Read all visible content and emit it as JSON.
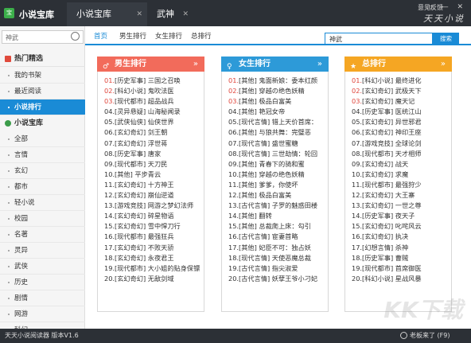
{
  "app": {
    "title": "小说宝库",
    "logo": "宝",
    "feedback": "意见反馈",
    "window_controls": "▭ — ✕",
    "brand": "天天小说"
  },
  "tabs": [
    {
      "label": "小说宝库",
      "close": "✕"
    },
    {
      "label": "武神",
      "close": "✕"
    }
  ],
  "sidebar": {
    "search_placeholder": "神武",
    "section1": "热门精选",
    "items1": [
      {
        "label": "我的书架"
      },
      {
        "label": "最近阅读"
      },
      {
        "label": "小说排行"
      }
    ],
    "section2": "小说宝库",
    "items2": [
      {
        "label": "全部"
      },
      {
        "label": "言情"
      },
      {
        "label": "玄幻"
      },
      {
        "label": "都市"
      },
      {
        "label": "轻小说"
      },
      {
        "label": "校园"
      },
      {
        "label": "名著"
      },
      {
        "label": "灵异"
      },
      {
        "label": "武侠"
      },
      {
        "label": "历史"
      },
      {
        "label": "剧情"
      },
      {
        "label": "网游"
      },
      {
        "label": "科幻"
      }
    ]
  },
  "main": {
    "tabs": [
      {
        "label": "首页"
      },
      {
        "label": "男生排行"
      },
      {
        "label": "女生排行"
      },
      {
        "label": "总排行"
      }
    ],
    "search_value": "神武",
    "search_button": "搜索"
  },
  "rankings": [
    {
      "title": "男生排行",
      "icon": "male-icon",
      "color": "#f26b5b",
      "more": "»",
      "items": [
        {
          "num": "01.",
          "text": "[历史军事] 三国之召唤"
        },
        {
          "num": "02.",
          "text": "[科幻小说] 鬼吹法医"
        },
        {
          "num": "03.",
          "text": "[现代都市] 超品战兵"
        },
        {
          "num": "04.",
          "text": "[灵异悬疑] 山海秘闻录"
        },
        {
          "num": "05.",
          "text": "[武侠仙侠] 仙侠世界"
        },
        {
          "num": "06.",
          "text": "[玄幻奇幻] 剑王朝"
        },
        {
          "num": "07.",
          "text": "[玄幻奇幻] 浮世蒋"
        },
        {
          "num": "08.",
          "text": "[历史军事] 唐家"
        },
        {
          "num": "09.",
          "text": "[现代都市] 天刀民"
        },
        {
          "num": "10.",
          "text": "[其他] 平步青云"
        },
        {
          "num": "11.",
          "text": "[玄幻奇幻] 十方神王"
        },
        {
          "num": "12.",
          "text": "[玄幻奇幻] 崩仙逆道"
        },
        {
          "num": "13.",
          "text": "[游戏竞技] 网游之梦幻法师"
        },
        {
          "num": "14.",
          "text": "[玄幻奇幻] 碎星物语"
        },
        {
          "num": "15.",
          "text": "[玄幻奇幻] 雪中悍刀行"
        },
        {
          "num": "16.",
          "text": "[现代都市] 最强狂兵"
        },
        {
          "num": "17.",
          "text": "[玄幻奇幻] 不败天骄"
        },
        {
          "num": "18.",
          "text": "[玄幻奇幻] 永夜君王"
        },
        {
          "num": "19.",
          "text": "[现代都市] 大小姐的贴身保镖"
        },
        {
          "num": "20.",
          "text": "[玄幻奇幻] 无敌剑域"
        }
      ]
    },
    {
      "title": "女生排行",
      "icon": "female-icon",
      "color": "#2d9ad8",
      "more": "»",
      "items": [
        {
          "num": "01.",
          "text": "[其他] 鬼面新娘：委本红颜"
        },
        {
          "num": "02.",
          "text": "[其他] 穿越の绝色妖精"
        },
        {
          "num": "03.",
          "text": "[其他] 极品白富美"
        },
        {
          "num": "04.",
          "text": "[其他] 艳冠女帝"
        },
        {
          "num": "05.",
          "text": "[现代言情] 错上天价首席："
        },
        {
          "num": "06.",
          "text": "[其他] 与狼共舞：完璧恶"
        },
        {
          "num": "07.",
          "text": "[现代言情] 盛世蜜糖"
        },
        {
          "num": "08.",
          "text": "[现代言情] 三世劫情：轮回"
        },
        {
          "num": "09.",
          "text": "[其他] 青春下的骑和蜜"
        },
        {
          "num": "10.",
          "text": "[其他] 穿越の绝色妖精"
        },
        {
          "num": "11.",
          "text": "[其他] 爹爹，你使坏"
        },
        {
          "num": "12.",
          "text": "[其他] 极品白富美"
        },
        {
          "num": "13.",
          "text": "[古代言情] 子罗的魅惑田楼"
        },
        {
          "num": "14.",
          "text": "[其他] 翻转"
        },
        {
          "num": "15.",
          "text": "[其他] 总裁爬上床：勾引"
        },
        {
          "num": "16.",
          "text": "[古代言情] 宦妻首略"
        },
        {
          "num": "17.",
          "text": "[其他] 妃臣不可：独占妖"
        },
        {
          "num": "18.",
          "text": "[现代言情] 天使恶魔总裁"
        },
        {
          "num": "19.",
          "text": "[古代言情] 指尖淑爱"
        },
        {
          "num": "20.",
          "text": "[古代言情] 妖孽王爷小刁妃"
        }
      ]
    },
    {
      "title": "总排行",
      "icon": "trophy-icon",
      "color": "#f5a623",
      "more": "»",
      "items": [
        {
          "num": "01.",
          "text": "[科幻小说] 最终进化"
        },
        {
          "num": "02.",
          "text": "[玄幻奇幻] 武极天下"
        },
        {
          "num": "03.",
          "text": "[玄幻奇幻] 魔天记"
        },
        {
          "num": "04.",
          "text": "[历史军事] 医统江山"
        },
        {
          "num": "05.",
          "text": "[玄幻奇幻] 异世邪君"
        },
        {
          "num": "06.",
          "text": "[玄幻奇幻] 神印王座"
        },
        {
          "num": "07.",
          "text": "[游戏竞技] 全球论剑"
        },
        {
          "num": "08.",
          "text": "[现代都市] 天才相师"
        },
        {
          "num": "09.",
          "text": "[玄幻奇幻] 战天"
        },
        {
          "num": "10.",
          "text": "[玄幻奇幻] 求魔"
        },
        {
          "num": "11.",
          "text": "[现代都市] 最强狩少"
        },
        {
          "num": "12.",
          "text": "[玄幻奇幻] 大王寨"
        },
        {
          "num": "13.",
          "text": "[玄幻奇幻] 一世之尊"
        },
        {
          "num": "14.",
          "text": "[历史军事] 夜天子"
        },
        {
          "num": "15.",
          "text": "[玄幻奇幻] 叱咤风云"
        },
        {
          "num": "16.",
          "text": "[玄幻奇幻] 执决"
        },
        {
          "num": "17.",
          "text": "[幻想言情] 杀神"
        },
        {
          "num": "18.",
          "text": "[历史军事] 曹贼"
        },
        {
          "num": "19.",
          "text": "[现代都市] 首席御医"
        },
        {
          "num": "20.",
          "text": "[科幻小说] 星战风暴"
        }
      ]
    }
  ],
  "statusbar": {
    "left": "天天小说阅读器  版本V1.6",
    "right": "老板来了 (F9)"
  },
  "watermark": "KK下载"
}
